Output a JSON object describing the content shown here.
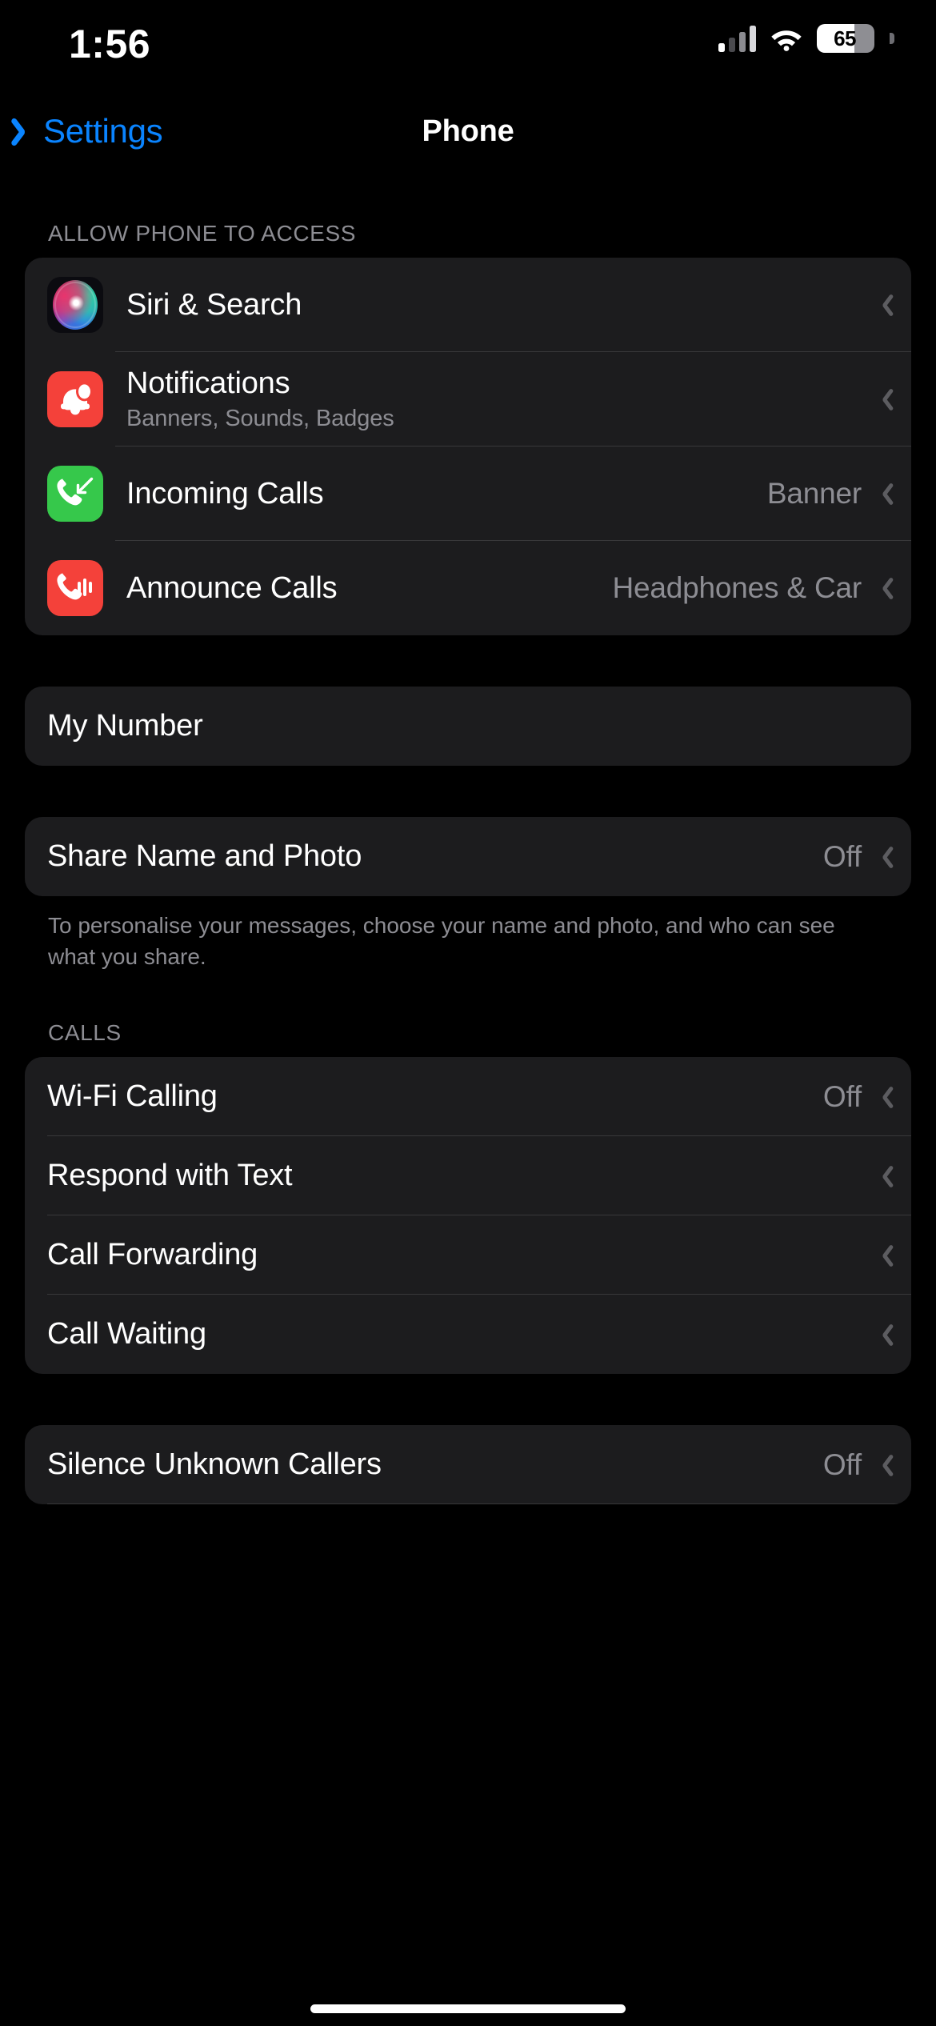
{
  "status_bar": {
    "time": "1:56",
    "battery_percent": "65",
    "battery_level": 65,
    "icons": [
      "cellular-signal-icon",
      "wifi-icon",
      "battery-icon"
    ]
  },
  "nav": {
    "back_label": "Settings",
    "title": "Phone"
  },
  "sections": [
    {
      "header": "ALLOW PHONE TO ACCESS",
      "rows": [
        {
          "title": "Siri & Search",
          "subtitle": "",
          "value": "",
          "icon": "siri-icon"
        },
        {
          "title": "Notifications",
          "subtitle": "Banners, Sounds, Badges",
          "value": "",
          "icon": "notifications-bell-icon"
        },
        {
          "title": "Incoming Calls",
          "subtitle": "",
          "value": "Banner",
          "icon": "incoming-calls-icon"
        },
        {
          "title": "Announce Calls",
          "subtitle": "",
          "value": "Headphones & Car",
          "icon": "announce-calls-icon"
        }
      ]
    },
    {
      "header": "",
      "rows": [
        {
          "title": "My Number",
          "subtitle": "",
          "value": "",
          "icon": ""
        }
      ]
    },
    {
      "header": "",
      "footer": "To personalise your messages, choose your name and photo, and who can see what you share.",
      "rows": [
        {
          "title": "Share Name and Photo",
          "subtitle": "",
          "value": "Off",
          "icon": ""
        }
      ]
    },
    {
      "header": "CALLS",
      "rows": [
        {
          "title": "Wi-Fi Calling",
          "subtitle": "",
          "value": "Off",
          "icon": ""
        },
        {
          "title": "Respond with Text",
          "subtitle": "",
          "value": "",
          "icon": ""
        },
        {
          "title": "Call Forwarding",
          "subtitle": "",
          "value": "",
          "icon": ""
        },
        {
          "title": "Call Waiting",
          "subtitle": "",
          "value": "",
          "icon": ""
        }
      ]
    },
    {
      "header": "",
      "rows": [
        {
          "title": "Silence Unknown Callers",
          "subtitle": "",
          "value": "Off",
          "icon": ""
        }
      ]
    }
  ],
  "colors": {
    "accent_blue": "#0a84ff",
    "row_background": "#1c1c1e",
    "page_background": "#000000",
    "secondary_text": "#8d8d93",
    "separator": "#38383a",
    "green_icon": "#36c84b",
    "red_icon": "#f4413a"
  }
}
